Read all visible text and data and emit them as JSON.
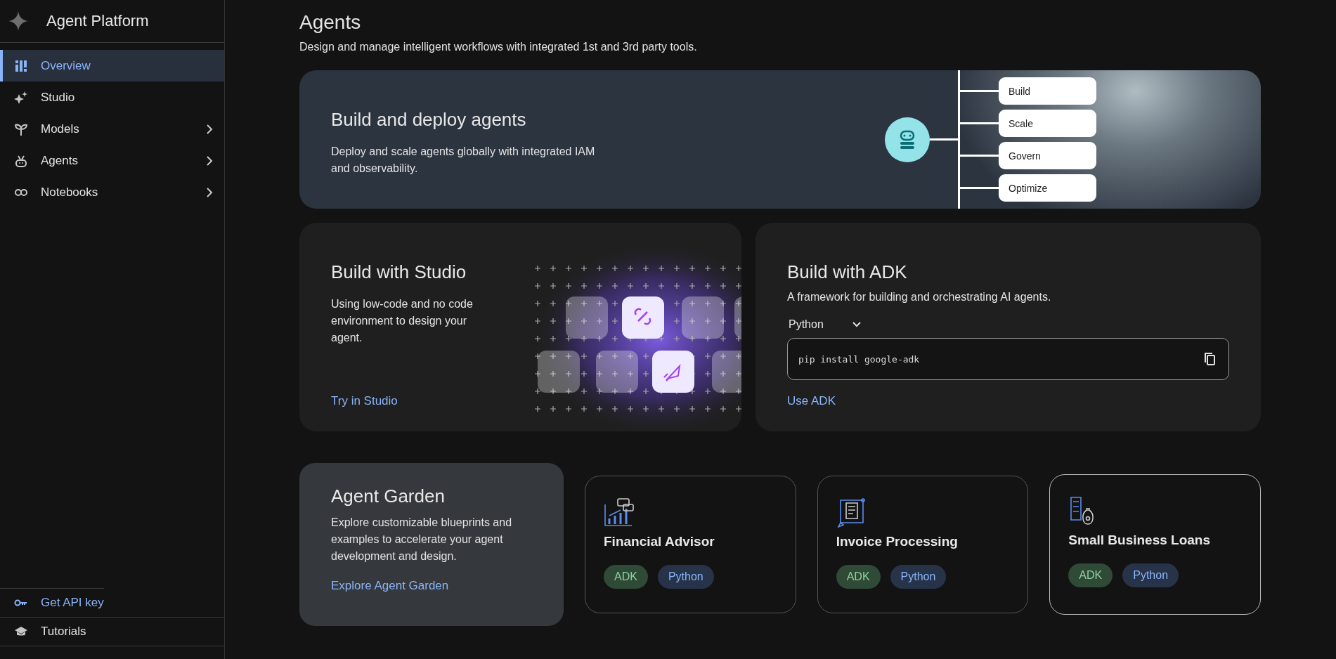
{
  "sidebar": {
    "title": "Agent Platform",
    "items": [
      {
        "label": "Overview",
        "selected": true,
        "expandable": false
      },
      {
        "label": "Studio",
        "selected": false,
        "expandable": false
      },
      {
        "label": "Models",
        "selected": false,
        "expandable": true
      },
      {
        "label": "Agents",
        "selected": false,
        "expandable": true
      },
      {
        "label": "Notebooks",
        "selected": false,
        "expandable": true
      }
    ],
    "footer": [
      {
        "label": "Get API key",
        "kind": "link"
      },
      {
        "label": "Tutorials",
        "kind": "plain"
      }
    ]
  },
  "page": {
    "title": "Agents",
    "subtitle": "Design and manage intelligent workflows with integrated 1st and 3rd party tools."
  },
  "banner": {
    "title": "Build and deploy agents",
    "text": "Deploy and scale agents globally with integrated IAM and observability.",
    "steps": [
      "Build",
      "Scale",
      "Govern",
      "Optimize"
    ]
  },
  "studio": {
    "title": "Build with Studio",
    "text": "Using low-code and no code environment to design your agent.",
    "link": "Try in Studio"
  },
  "adk": {
    "title": "Build with ADK",
    "text": "A framework for building and orchestrating AI agents.",
    "language": "Python",
    "command": "pip install google-adk",
    "link": "Use ADK"
  },
  "garden": {
    "title": "Agent Garden",
    "text": "Explore customizable blueprints and examples to accelerate your agent development and design.",
    "link": "Explore Agent Garden"
  },
  "samples": [
    {
      "title": "Financial Advisor",
      "hovered": false,
      "tags": [
        {
          "label": "ADK",
          "kind": "framework"
        },
        {
          "label": "Python",
          "kind": "language"
        }
      ]
    },
    {
      "title": "Invoice Processing",
      "hovered": false,
      "tags": [
        {
          "label": "ADK",
          "kind": "framework"
        },
        {
          "label": "Python",
          "kind": "language"
        }
      ]
    },
    {
      "title": "Small Business Loans",
      "hovered": true,
      "tags": [
        {
          "label": "ADK",
          "kind": "framework"
        },
        {
          "label": "Python",
          "kind": "language"
        }
      ]
    }
  ]
}
